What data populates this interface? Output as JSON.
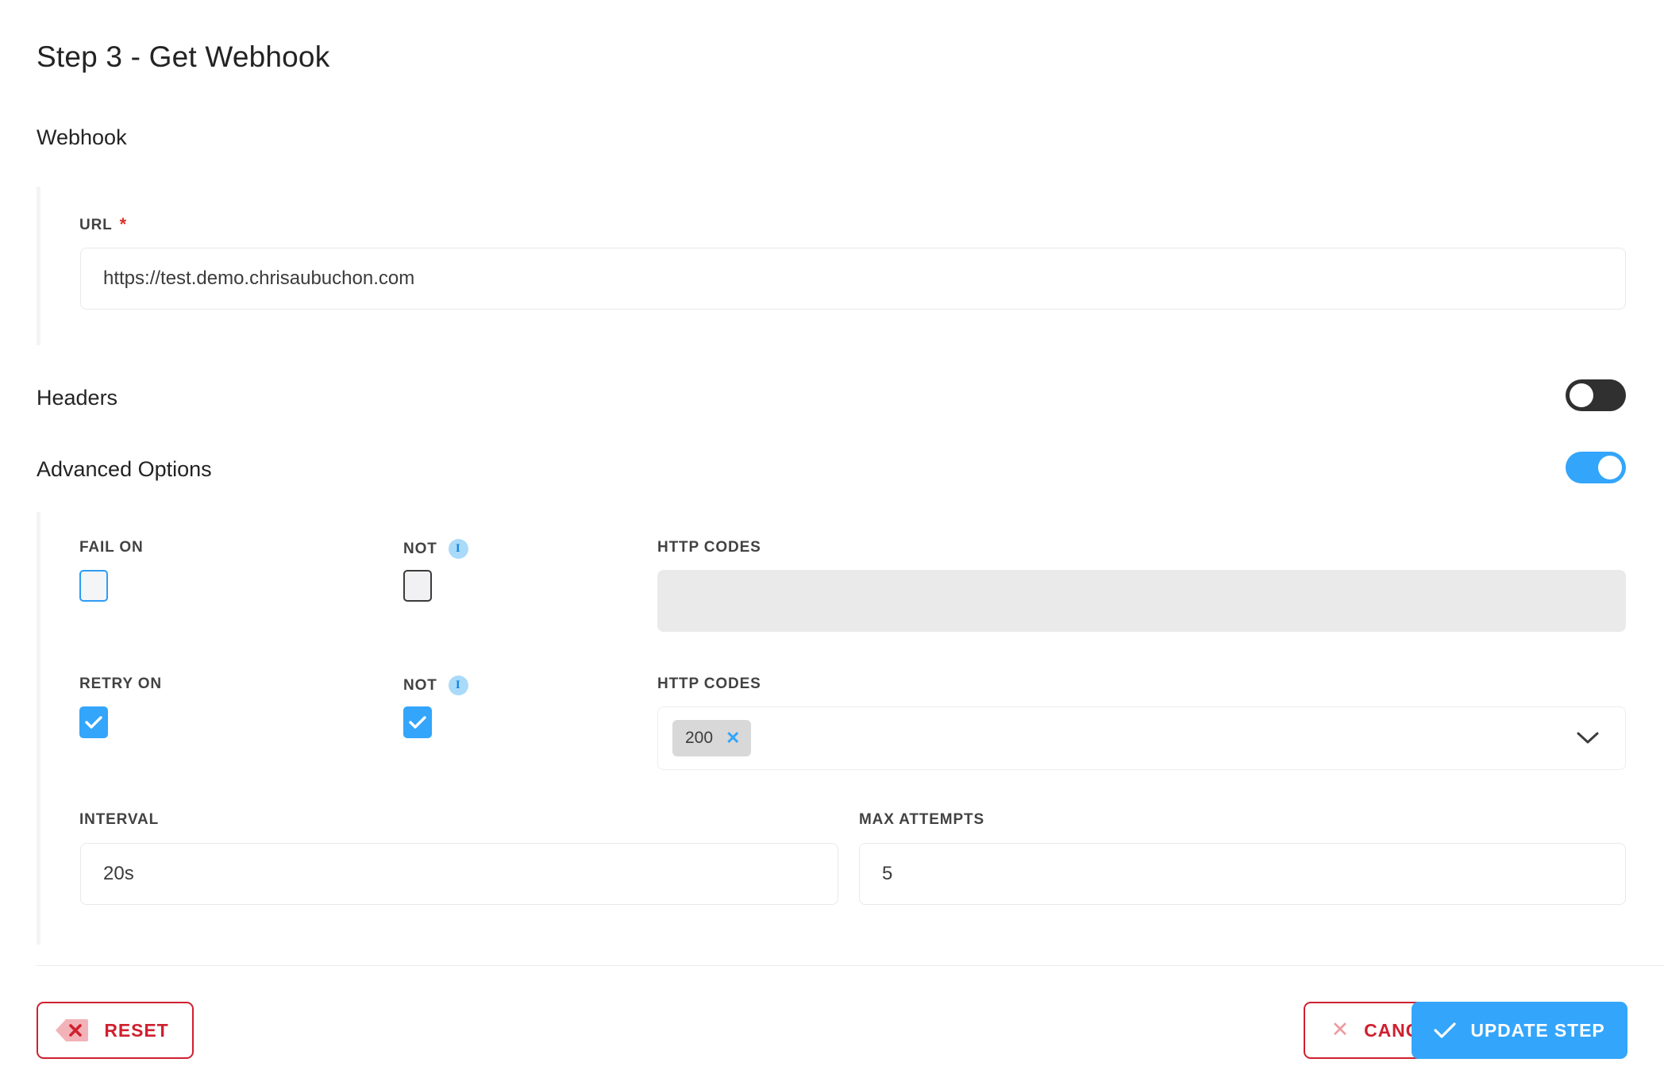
{
  "header": {
    "title": "Step 3 - Get Webhook"
  },
  "sections": {
    "webhook": {
      "heading": "Webhook",
      "url": {
        "label": "URL",
        "required_marker": "*",
        "value": "https://test.demo.chrisaubuchon.com",
        "placeholder": "https://"
      }
    },
    "headers": {
      "heading": "Headers",
      "toggle_state": "off"
    },
    "advanced": {
      "heading": "Advanced Options",
      "toggle_state": "on",
      "fail_on": {
        "label": "FAIL ON",
        "checked": false,
        "not_label": "NOT",
        "not_checked": false,
        "not_info_icon": "info-icon",
        "http_codes_label": "HTTP CODES",
        "http_codes_values": [],
        "http_codes_disabled": true
      },
      "retry_on": {
        "label": "RETRY ON",
        "checked": true,
        "not_label": "NOT",
        "not_checked": true,
        "not_info_icon": "info-icon",
        "http_codes_label": "HTTP CODES",
        "http_codes_values": [
          "200"
        ],
        "http_codes_disabled": false,
        "chip_remove_icon": "close-icon",
        "dropdown_icon": "chevron-down-icon"
      },
      "interval": {
        "label": "INTERVAL",
        "value": "20s",
        "placeholder": "20s"
      },
      "max_attempts": {
        "label": "MAX ATTEMPTS",
        "value": "5",
        "placeholder": "5"
      }
    }
  },
  "footer": {
    "reset_label": "RESET",
    "reset_icon": "backspace-icon",
    "cancel_label": "CANCEL",
    "cancel_icon": "close-icon",
    "update_label": "UPDATE STEP",
    "update_icon": "check-icon"
  },
  "colors": {
    "accent_blue": "#33a5fb",
    "danger_red": "#cf202f",
    "required_red": "#d93025",
    "toggle_off": "#303030",
    "disabled_gray": "#eaeaea",
    "chip_gray": "#d8d8d8",
    "info_badge": "#a9daf9"
  }
}
